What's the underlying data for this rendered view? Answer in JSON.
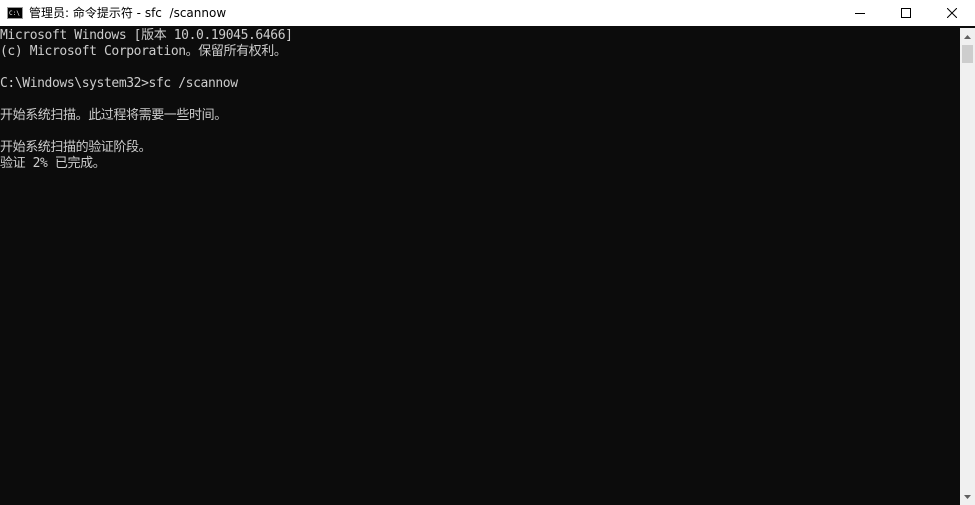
{
  "window": {
    "title": "管理员: 命令提示符 - sfc  /scannow",
    "icon": "cmd-icon",
    "icon_glyph": "C:\\"
  },
  "controls": {
    "minimize": "minimize-icon",
    "maximize": "maximize-icon",
    "close": "close-icon"
  },
  "console": {
    "lines": [
      "Microsoft Windows [版本 10.0.19045.6466]",
      "(c) Microsoft Corporation。保留所有权利。",
      "",
      "C:\\Windows\\system32>sfc /scannow",
      "",
      "开始系统扫描。此过程将需要一些时间。",
      "",
      "开始系统扫描的验证阶段。",
      "验证 2% 已完成。"
    ]
  },
  "colors": {
    "console_background": "#0c0c0c",
    "console_text": "#cccccc",
    "titlebar_background": "#ffffff"
  }
}
